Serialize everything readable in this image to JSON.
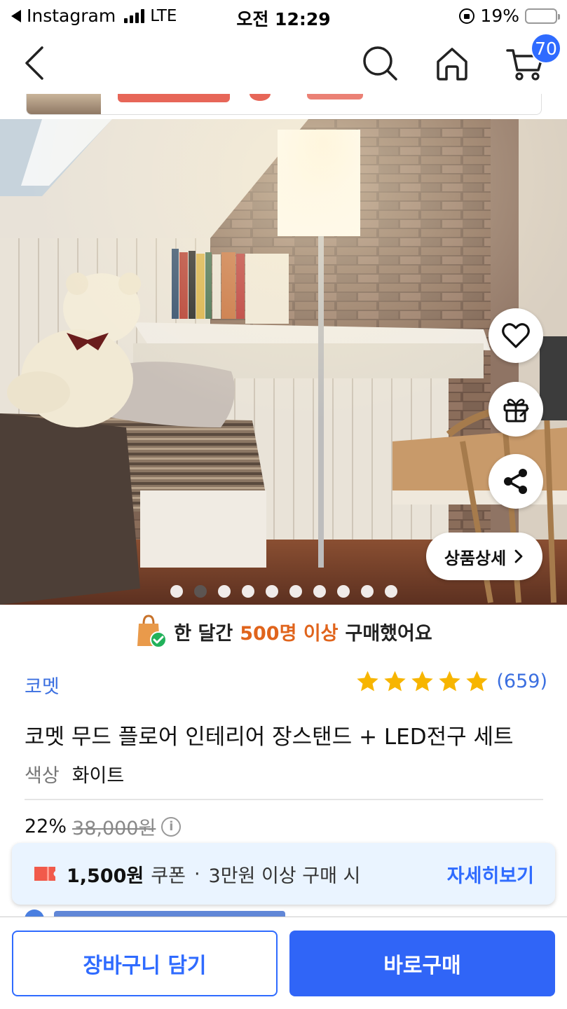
{
  "status_bar": {
    "back_app": "Instagram",
    "network": "LTE",
    "time": "오전 12:29",
    "battery": "19%",
    "battery_level": 0.19
  },
  "header": {
    "cart_count": "70",
    "icons": [
      "back-arrow-icon",
      "search-icon",
      "home-icon",
      "cart-icon"
    ]
  },
  "gallery": {
    "total_images": 10,
    "active_index": 1,
    "detail_button": "상품상세"
  },
  "purchase_banner": {
    "prefix": "한 달간",
    "highlight": "500명 이상",
    "suffix": "구매했어요"
  },
  "product": {
    "brand": "코멧",
    "rating_stars": 5,
    "review_count": "(659)",
    "title": "코멧 무드 플로어 인테리어 장스탠드 + LED전구 세트",
    "option_label": "색상",
    "option_value": "화이트",
    "discount": "22%",
    "original_price": "38,000원"
  },
  "coupon": {
    "amount": "1,500원",
    "label": "쿠폰",
    "separator": "·",
    "condition": "3만원 이상 구매 시",
    "more": "자세히보기"
  },
  "actions": {
    "add_to_cart": "장바구니 담기",
    "buy_now": "바로구매"
  },
  "colors": {
    "accent": "#2f6bff",
    "highlight": "#e0641c",
    "star": "#f7b500"
  }
}
